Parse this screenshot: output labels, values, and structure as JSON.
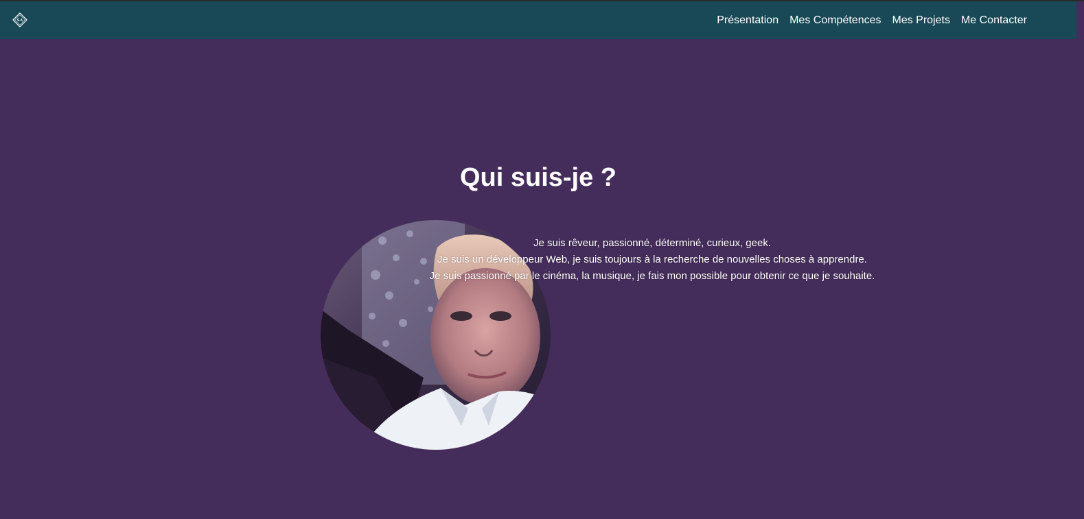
{
  "header": {
    "logo_text": "S.A",
    "nav": [
      {
        "label": "Présentation"
      },
      {
        "label": "Mes Compétences"
      },
      {
        "label": "Mes Projets"
      },
      {
        "label": "Me Contacter"
      }
    ]
  },
  "main": {
    "title": "Qui suis-je ?",
    "bio_lines": [
      "Je suis rêveur, passionné, déterminé, curieux, geek.",
      "Je suis un développeur Web, je suis toujours à la recherche de nouvelles choses à apprendre.",
      "Je suis passionné par le cinéma, la musique, je fais mon possible pour obtenir ce que je souhaite."
    ]
  },
  "colors": {
    "navbar": "#194856",
    "background": "#452d5b",
    "text": "#ffffff"
  }
}
